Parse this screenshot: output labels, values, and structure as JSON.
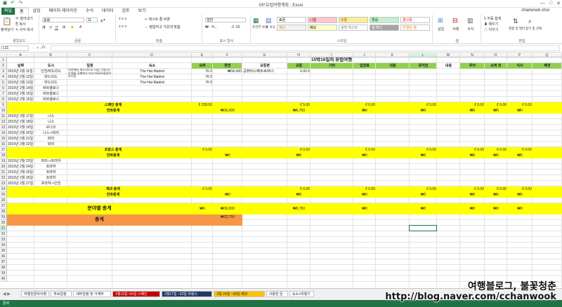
{
  "window": {
    "title": "MY유럽여행계획 - Excel",
    "minimize": "—",
    "restore": "□",
    "close": "✕"
  },
  "menu": {
    "file": "파일",
    "items": [
      "홈",
      "삽입",
      "페이지 레이아웃",
      "수식",
      "데이터",
      "검토",
      "보기"
    ],
    "user": "chanwook choi"
  },
  "ribbon": {
    "clipboard": {
      "paste": "붙여넣기",
      "cut": "잘라내기",
      "copy": "복사",
      "format_painter": "서식 복사",
      "label": "클립보드"
    },
    "font": {
      "name": "돋움",
      "size": "11",
      "label": "글꼴"
    },
    "align": {
      "wrap": "텍스트 줄 바꿈",
      "merge": "병합하고 가운데 맞춤",
      "label": "맞춤"
    },
    "number": {
      "format": "일반",
      "label": "표시 형식"
    },
    "styles": {
      "conditional": "조건부 서식",
      "table": "표 서식",
      "boxes": [
        {
          "label": "표준",
          "bg": "#ffffff",
          "fg": "#000000"
        },
        {
          "label": "나쁨",
          "bg": "#ffc7ce",
          "fg": "#9c0006"
        },
        {
          "label": "보통",
          "bg": "#ffeb9c",
          "fg": "#9c6500"
        },
        {
          "label": "좋음",
          "bg": "#c6efce",
          "fg": "#006100"
        },
        {
          "label": "경고문",
          "bg": "#ffffff",
          "fg": "#ff0000"
        },
        {
          "label": "계산",
          "bg": "#f2f2f2",
          "fg": "#fa7d00"
        },
        {
          "label": "메모",
          "bg": "#ffffcc",
          "fg": "#000000"
        },
        {
          "label": "설명 텍스트",
          "bg": "#ffffff",
          "fg": "#7f7f7f"
        },
        {
          "label": "셀 확인",
          "bg": "#a5a5a5",
          "fg": "#ffffff"
        },
        {
          "label": "연결된 셀",
          "bg": "#ffffff",
          "fg": "#fa7d00"
        }
      ],
      "label": "스타일"
    },
    "cells": {
      "insert": "삽입",
      "delete": "삭제",
      "format": "서식",
      "label": "셀"
    },
    "editing": {
      "autosum": "자동 합계",
      "fill": "채우기",
      "clear": "지우기",
      "sort": "정렬 및 필터",
      "find": "찾기 및 선택",
      "label": "편집"
    }
  },
  "formula_bar": {
    "name_box": "L31",
    "fx": "fx",
    "content": ""
  },
  "columns": [
    "A",
    "B",
    "C",
    "D",
    "E",
    "F",
    "G",
    "H",
    "I",
    "J",
    "K",
    "L",
    "M",
    "N",
    "O",
    "P",
    "Q"
  ],
  "selected_column": "L",
  "selected_row": "31",
  "sheet": {
    "title": "15박16일의 유럽여행",
    "headers": [
      "날짜",
      "도시",
      "일정",
      "숙소",
      "숙박",
      "환전",
      "교통편",
      "교통",
      "기타",
      "입장료",
      "내용",
      "뮤지엄",
      "내용",
      "투어",
      "슈퍼 외",
      "식사",
      "패션"
    ],
    "row3": {
      "date": "2015년 2월 11일 수요일",
      "city": "인천/마드리드",
      "itinerary": "인천에서 마드리드로 이동 / 마드리드에서 공항버스 타고 마요르광장으로이동",
      "hotel": "The Hat Madrid",
      "lodging": "76 €",
      "exchange": "₩16,000",
      "transport_mode": "공항버스/메트로/버스",
      "transport": "5.00 €"
    },
    "rows_spain": [
      {
        "date": "2015년 2월 12일 목요일",
        "city": "마드리드",
        "hotel": "The Hat Madrid",
        "lodging": "76 €"
      },
      {
        "date": "2015년 2월 13일 금요일",
        "city": "마드리드",
        "hotel": "The Hat Madrid",
        "lodging": "76 €"
      },
      {
        "date": "2015년 2월 14일 토요일",
        "city": "바르셀로나",
        "hotel": "",
        "lodging": ""
      },
      {
        "date": "2015년 2월 15일 일요일",
        "city": "바르셀로나",
        "hotel": "",
        "lodging": ""
      },
      {
        "date": "2015년 2월 16일 월요일",
        "city": "바르셀로나",
        "hotel": "",
        "lodging": ""
      }
    ],
    "spain_total": {
      "label": "스페인 총계",
      "lodging": "€ 228.00",
      "transport": "€ 5.00",
      "admission": "€ 0.00",
      "museum": "€ 0.00",
      "tour": "€ 0.00",
      "super": "€ 0.00",
      "meal": "€ 0.00"
    },
    "spain_krw": {
      "label": "한화총계",
      "exchange": "₩16,000",
      "transport": "₩6,750",
      "admission": "₩0",
      "museum": "₩0",
      "tour": "₩0",
      "super": "₩0",
      "meal": "₩0"
    },
    "rows_france": [
      {
        "date": "2015년 2월 17일 화요일",
        "city": "니스"
      },
      {
        "date": "2015년 2월 18일 수요일",
        "city": "니스"
      },
      {
        "date": "2015년 2월 19일 목요일",
        "city": "모나코"
      },
      {
        "date": "2015년 2월 20일 금요일",
        "city": "니스->파리"
      },
      {
        "date": "2015년 2월 21일 토요일",
        "city": "파리"
      },
      {
        "date": "2015년 2월 22일 일요일",
        "city": "파리"
      }
    ],
    "france_total": {
      "label": "프랑스 총계",
      "lodging": "€ 0.00",
      "transport": "€ 0.00",
      "admission": "€ 0.00",
      "museum": "€ 0.00",
      "tour": "€ 0.00",
      "super": "€ 0.00",
      "meal": "€ 0.00"
    },
    "france_krw": {
      "label": "한화총계",
      "exchange": "₩0",
      "transport": "₩0",
      "admission": "₩0",
      "museum": "₩0",
      "tour": "₩0",
      "super": "₩0",
      "meal": "₩0"
    },
    "rows_czech": [
      {
        "date": "2015년 2월 23일 월요일",
        "city": "파리->프라하"
      },
      {
        "date": "2015년 2월 24일 화요일",
        "city": "프라하"
      },
      {
        "date": "2015년 2월 25일 수요일",
        "city": "프라하"
      },
      {
        "date": "2015년 2월 26일 목요일",
        "city": "프라하"
      },
      {
        "date": "2015년 2월 27일 금요일",
        "city": "프라하->인천"
      }
    ],
    "czech_total": {
      "label": "체코 총계",
      "lodging": "€ 0.00",
      "transport": "€ 0.00",
      "admission": "€ 0.00",
      "museum": "€ 0.00",
      "tour": "€ 0.00",
      "super": "€ 0.00",
      "meal": "€ 0.00"
    },
    "czech_krw": {
      "label": "한화총계",
      "exchange": "₩0",
      "transport": "₩0",
      "admission": "₩0",
      "museum": "₩0",
      "tour": "₩0",
      "super": "₩0",
      "meal": "₩0"
    },
    "category_total": {
      "label": "분야별 총계",
      "lodging": "₩0",
      "exchange": "₩16,000",
      "transport": "₩6,750",
      "admission": "₩0",
      "museum": "₩0",
      "tour": "₩0",
      "super": "₩0",
      "meal": "₩0"
    },
    "grand_total": {
      "label": "총계",
      "value": "₩22,750"
    }
  },
  "sheet_tabs": [
    {
      "label": "여행전준비사항",
      "bg": "#ffffff",
      "fg": "#222222"
    },
    {
      "label": "주요일정",
      "bg": "#ffffff",
      "fg": "#222222"
    },
    {
      "label": "세부일정 및 가계부",
      "bg": "#ffffff",
      "fg": "#222222"
    },
    {
      "label": "2월11일~16일 스페인",
      "bg": "#c00000",
      "fg": "#ffffff"
    },
    {
      "label": "2월17일 ~22일 프랑스",
      "bg": "#1f3864",
      "fg": "#ffffff"
    },
    {
      "label": "2월 24일 ~28일 체코",
      "bg": "#ffc000",
      "fg": "#222222"
    },
    {
      "label": "사용한 돈",
      "bg": "#ffffff",
      "fg": "#222222"
    },
    {
      "label": "숙소+비행기",
      "bg": "#ffffff",
      "fg": "#222222"
    }
  ],
  "status": {
    "ready": "준비"
  },
  "watermark": {
    "line1": "여행블로그, 불꽃청춘",
    "line2": "http://blog.naver.com/cchanwook"
  }
}
